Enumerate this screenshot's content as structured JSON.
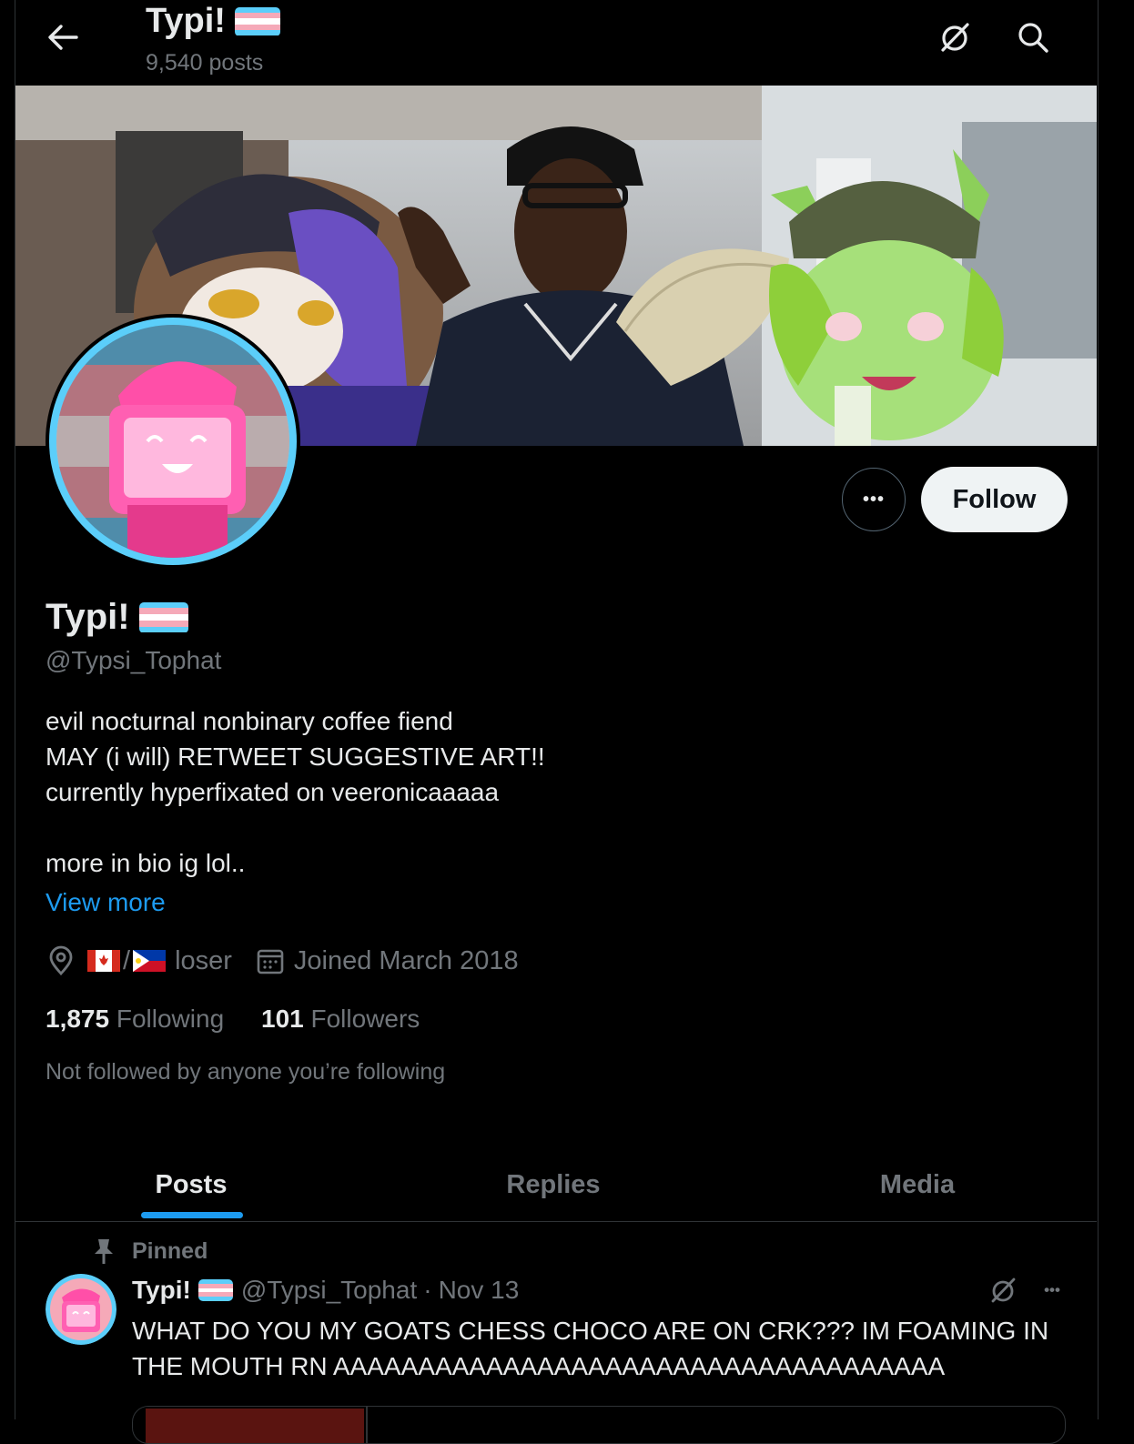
{
  "header": {
    "name": "Typi!",
    "posts_count": "9,540 posts"
  },
  "colors": {
    "trans_blue": "#5bcefa",
    "trans_pink": "#f5a9b8",
    "white": "#ffffff",
    "link": "#1d9bf0",
    "muted": "#71767b"
  },
  "profile": {
    "display_name": "Typi!",
    "handle": "@Typsi_Tophat",
    "bio_lines": [
      "evil nocturnal nonbinary coffee fiend",
      "MAY (i will) RETWEET SUGGESTIVE ART!!",
      "currently hyperfixated on veeronicaaaaa",
      "more in bio ig lol.."
    ],
    "view_more": "View more",
    "location_suffix": "loser",
    "location_separator": "/",
    "joined": "Joined March 2018",
    "following_count": "1,875",
    "following_label": "Following",
    "followers_count": "101",
    "followers_label": "Followers",
    "not_followed": "Not followed by anyone you’re following"
  },
  "actions": {
    "follow_label": "Follow",
    "more_label": "•••"
  },
  "tabs": [
    {
      "label": "Posts",
      "active": true
    },
    {
      "label": "Replies",
      "active": false
    },
    {
      "label": "Media",
      "active": false
    }
  ],
  "pinned_post": {
    "pinned_label": "Pinned",
    "author_name": "Typi!",
    "handle": "@Typsi_Tophat",
    "separator": "·",
    "date": "Nov 13",
    "more_label": "•••",
    "text_line1": "WHAT DO YOU MY GOATS CHESS CHOCO ARE ON CRK??? IM FOAMING IN",
    "text_line2": "THE MOUTH RN AAAAAAAAAAAAAAAAAAAAAAAAAAAAAAAAAAAA"
  },
  "icons": [
    "back-arrow-icon",
    "grok-icon",
    "search-icon",
    "location-icon",
    "calendar-icon",
    "pin-icon",
    "canada-flag-icon",
    "philippines-flag-icon",
    "trans-flag-icon"
  ]
}
